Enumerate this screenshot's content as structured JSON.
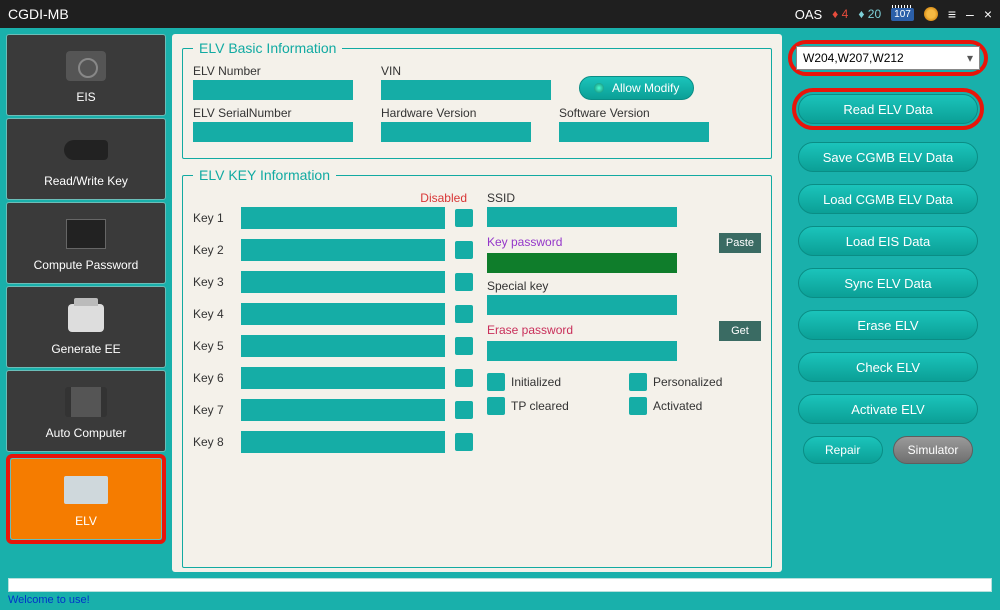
{
  "titlebar": {
    "title": "CGDI-MB",
    "oas": "OAS",
    "gem_red": "4",
    "gem_blue": "20",
    "calendar": "107"
  },
  "sidebar": {
    "items": [
      {
        "label": "EIS"
      },
      {
        "label": "Read/Write Key"
      },
      {
        "label": "Compute Password"
      },
      {
        "label": "Generate EE"
      },
      {
        "label": "Auto Computer"
      },
      {
        "label": "ELV"
      }
    ]
  },
  "basic": {
    "legend": "ELV Basic Information",
    "elv_number_label": "ELV Number",
    "vin_label": "VIN",
    "allow_modify": "Allow Modify",
    "serial_label": "ELV SerialNumber",
    "hw_label": "Hardware Version",
    "sw_label": "Software Version"
  },
  "keyinfo": {
    "legend": "ELV KEY Information",
    "disabled": "Disabled",
    "keys": [
      "Key 1",
      "Key 2",
      "Key 3",
      "Key 4",
      "Key 5",
      "Key 6",
      "Key 7",
      "Key 8"
    ],
    "ssid": "SSID",
    "key_password": "Key password",
    "paste": "Paste",
    "special_key": "Special key",
    "erase_password": "Erase password",
    "get": "Get",
    "status": {
      "initialized": "Initialized",
      "personalized": "Personalized",
      "tp_cleared": "TP cleared",
      "activated": "Activated"
    }
  },
  "rightcol": {
    "combo": "W204,W207,W212",
    "read": "Read  ELV Data",
    "save": "Save CGMB ELV Data",
    "load_cgmb": "Load CGMB ELV Data",
    "load_eis": "Load EIS Data",
    "sync": "Sync ELV Data",
    "erase": "Erase ELV",
    "check": "Check ELV",
    "activate": "Activate ELV",
    "repair": "Repair",
    "simulator": "Simulator"
  },
  "status": {
    "msg": "Welcome to use!"
  }
}
